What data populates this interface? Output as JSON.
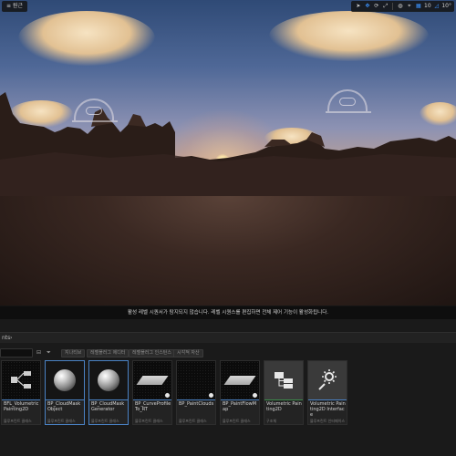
{
  "viewport": {
    "view_menu_label": "≡ 원근",
    "toolbar": {
      "grid_value": "10",
      "angle_value": "10°"
    },
    "message": "활성 레벨 시퀀서가 탐지되지 않습니다. 레벨 시퀀스를 편집하면 전체 제어 기능이 활성화됩니다."
  },
  "content_browser": {
    "title": "nts",
    "chips": [
      "지나티브",
      "레벨플러그 에디터",
      "레벨플러그 인스턴스",
      "시각적 자산"
    ],
    "assets": [
      {
        "name": "BFL_Volumetric Painting2D",
        "type": "블루프린트 클래스",
        "thumb": "graph-icon",
        "selected": false
      },
      {
        "name": "BP_CloudMask Object",
        "type": "블루프린트 클래스",
        "thumb": "sphere-icon",
        "selected": true
      },
      {
        "name": "BP_CloudMask Generator",
        "type": "블루프린트 클래스",
        "thumb": "sphere-icon",
        "selected": true
      },
      {
        "name": "BP_CurveProfile To_RT",
        "type": "블루프린트 클래스",
        "thumb": "plane-icon",
        "selected": false
      },
      {
        "name": "BP_PaintClouds",
        "type": "블루프린트 클래스",
        "thumb": "empty-icon",
        "selected": false
      },
      {
        "name": "BP_PaintFlowMap",
        "type": "블루프린트 클래스",
        "thumb": "plane-icon",
        "selected": false
      },
      {
        "name": "Volumetric Painting2D",
        "type": "구조체",
        "thumb": "struct-icon",
        "selected": false
      },
      {
        "name": "Volumetric Painting2D Interface",
        "type": "블루프린트 인터페이스",
        "thumb": "interface-icon",
        "selected": false
      }
    ]
  }
}
